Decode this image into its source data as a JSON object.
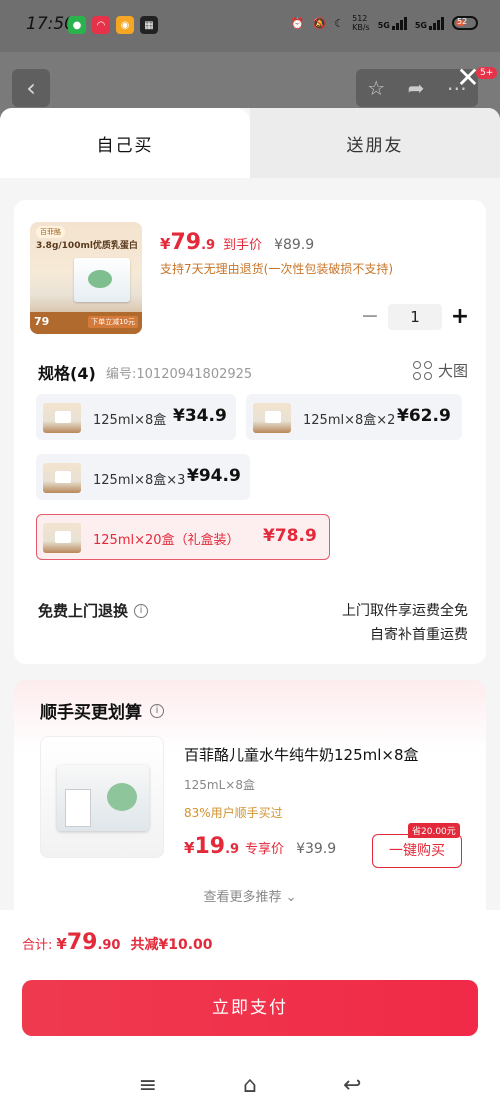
{
  "status": {
    "time": "17:50",
    "net_speed_top": "512",
    "net_speed_bottom": "KB/s",
    "sig1": "5G",
    "sig2": "5G",
    "battery": "52"
  },
  "sheet": {
    "tabs": [
      {
        "label": "自己买"
      },
      {
        "label": "送朋友"
      }
    ],
    "product": {
      "image_headline": "3.8g/100ml优质乳蛋白",
      "image_promo_price": "79",
      "image_promo_coupon": "下单立减10元",
      "price_yen": "¥",
      "price_int": "79",
      "price_dec": ".9",
      "price_label": "到手价",
      "original_price": "¥89.9",
      "return_note": "支持7天无理由退货(一次性包装破损不支持)"
    },
    "stepper": {
      "minus": "−",
      "qty": "1",
      "plus": "+"
    },
    "spec": {
      "title": "规格(4)",
      "code": "编号:10120941802925",
      "big_image": "大图"
    },
    "options": [
      {
        "label": "125ml×8盒",
        "price": "¥34.9"
      },
      {
        "label": "125ml×8盒×2",
        "price": "¥62.9"
      },
      {
        "label": "125ml×8盒×3",
        "price": "¥94.9"
      },
      {
        "label": "125ml×20盒（礼盒装）",
        "price": "¥78.9"
      }
    ],
    "free_return": {
      "title": "免费上门退换",
      "desc1": "上门取件享运费全免",
      "desc2": "自寄补首重运费"
    },
    "addon": {
      "header": "顺手买更划算",
      "name": "百菲酪儿童水牛纯牛奶125ml×8盒",
      "spec": "125mL×8盒",
      "buyers": "83%用户顺手买过",
      "price_yen": "¥",
      "price_int": "19",
      "price_dec": ".9",
      "price_label": "专享价",
      "original_price": "¥39.9",
      "save_tag": "省20.00元",
      "buy_label": "一键购买",
      "more": "查看更多推荐"
    },
    "footer": {
      "total_label": "合计:",
      "total_yen": "¥",
      "total_int": "79",
      "total_dec": ".90",
      "saved": "共减¥10.00",
      "pay_label": "立即支付"
    },
    "badge_count": "5+"
  },
  "colors": {
    "accent": "#e32a3a",
    "orange_note": "#c8752a",
    "selected_bg": "#fdeef0"
  }
}
